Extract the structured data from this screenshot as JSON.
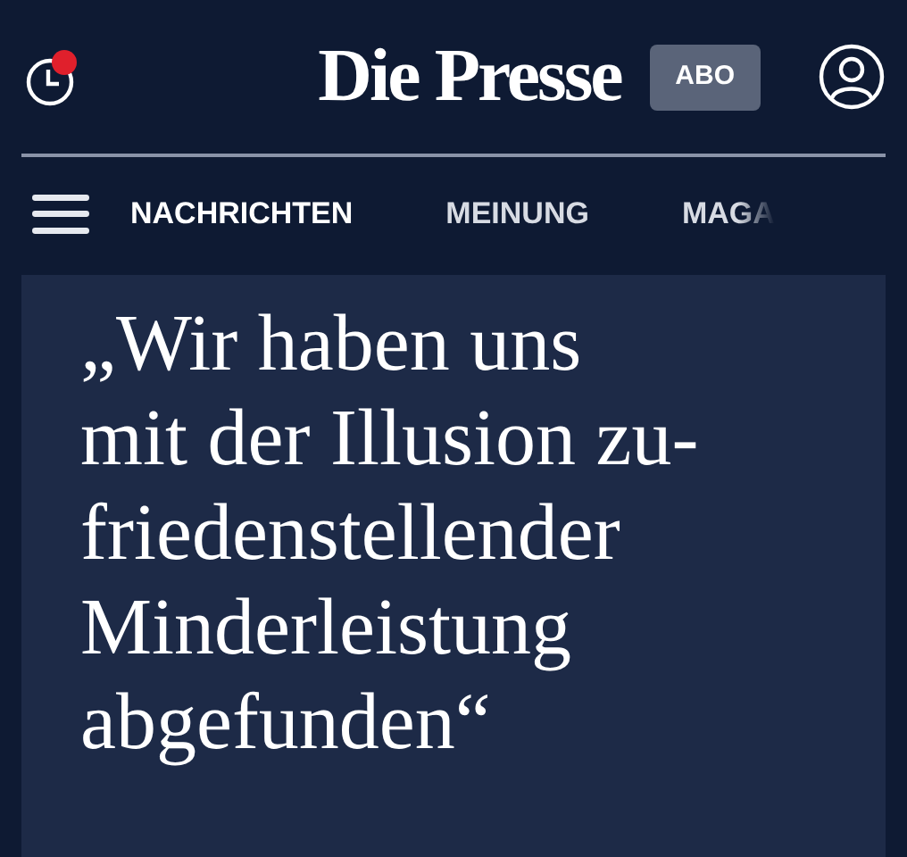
{
  "header": {
    "logo": "Die Presse",
    "subscribe_badge": "ABO"
  },
  "nav": {
    "tabs": [
      {
        "label": "NACHRICHTEN",
        "selected": true
      },
      {
        "label": "MEINUNG",
        "selected": false
      },
      {
        "label": "MAGA",
        "selected": false
      }
    ]
  },
  "article": {
    "headline": "„Wir haben uns\nmit der Illusion zu-\nfriedenstellender\nMinderleistung\nabgefunden“"
  }
}
